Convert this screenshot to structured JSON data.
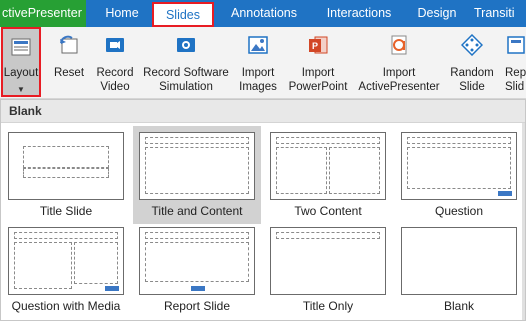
{
  "ribbon": {
    "tabs": [
      "Home",
      "Slides",
      "Annotations",
      "Interactions",
      "Design",
      "Transiti"
    ],
    "app_tab": "ctivePresenter",
    "active_tab": "Slides",
    "buttons": [
      {
        "label1": "Layout",
        "label2": "",
        "icon": "layout-icon"
      },
      {
        "label1": "Reset",
        "label2": "",
        "icon": "reset-icon"
      },
      {
        "label1": "Record",
        "label2": "Video",
        "icon": "video-camera-icon"
      },
      {
        "label1": "Record Software",
        "label2": "Simulation",
        "icon": "camera-icon"
      },
      {
        "label1": "Import",
        "label2": "Images",
        "icon": "image-icon"
      },
      {
        "label1": "Import",
        "label2": "PowerPoint",
        "icon": "powerpoint-icon"
      },
      {
        "label1": "Import",
        "label2": "ActivePresenter",
        "icon": "activepresenter-icon"
      },
      {
        "label1": "Random",
        "label2": "Slide",
        "icon": "dice-icon"
      },
      {
        "label1": "Rep",
        "label2": "Slid",
        "icon": "repeat-icon"
      }
    ]
  },
  "gallery": {
    "section": "Blank",
    "layouts": [
      {
        "label": "Title Slide",
        "selected": false
      },
      {
        "label": "Title and Content",
        "selected": true
      },
      {
        "label": "Two Content",
        "selected": false
      },
      {
        "label": "Question",
        "selected": false
      },
      {
        "label": "Question with Media",
        "selected": false
      },
      {
        "label": "Report Slide",
        "selected": false
      },
      {
        "label": "Title Only",
        "selected": false
      },
      {
        "label": "Blank",
        "selected": false
      }
    ]
  },
  "colors": {
    "tab_bar": "#1f73c4",
    "app_tab": "#27a034",
    "highlight": "#e81c23",
    "selected_item": "#d2d2d2",
    "accent_bar": "#3b77c4"
  }
}
